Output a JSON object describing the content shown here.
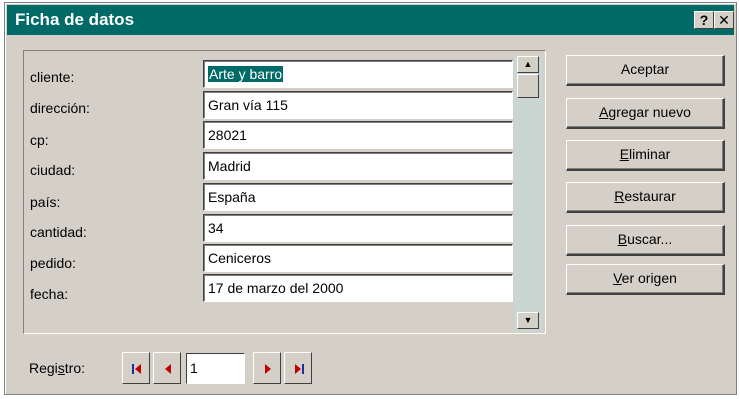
{
  "window": {
    "title": "Ficha de datos",
    "help_glyph": "?",
    "close_glyph": "✕"
  },
  "fields": [
    {
      "label": "cliente:",
      "value": "Arte y barro"
    },
    {
      "label": "dirección:",
      "value": "Gran vía 115"
    },
    {
      "label": "cp:",
      "value": "28021"
    },
    {
      "label": "ciudad:",
      "value": "Madrid"
    },
    {
      "label": "país:",
      "value": "España"
    },
    {
      "label": "cantidad:",
      "value": "34"
    },
    {
      "label": "pedido:",
      "value": "Ceniceros"
    },
    {
      "label": "fecha:",
      "value": "17 de marzo del 2000"
    }
  ],
  "buttons": {
    "aceptar": "Aceptar",
    "agregar": {
      "accel": "A",
      "rest": "gregar nuevo"
    },
    "eliminar": {
      "accel": "E",
      "rest": "liminar"
    },
    "restaurar": {
      "accel": "R",
      "rest": "estaurar"
    },
    "buscar": {
      "accel": "B",
      "rest": "uscar..."
    },
    "ver_origen": {
      "accel": "V",
      "rest": "er origen"
    }
  },
  "record_nav": {
    "label_pre": "Regi",
    "label_accel": "s",
    "label_post": "tro:",
    "current": "1"
  },
  "colors": {
    "titlebar": "#006a67",
    "face": "#d4d0c8",
    "scroll_track": "#c9d6d1",
    "nav_arrow": "#c00000",
    "nav_bar": "#1a2ea0"
  }
}
